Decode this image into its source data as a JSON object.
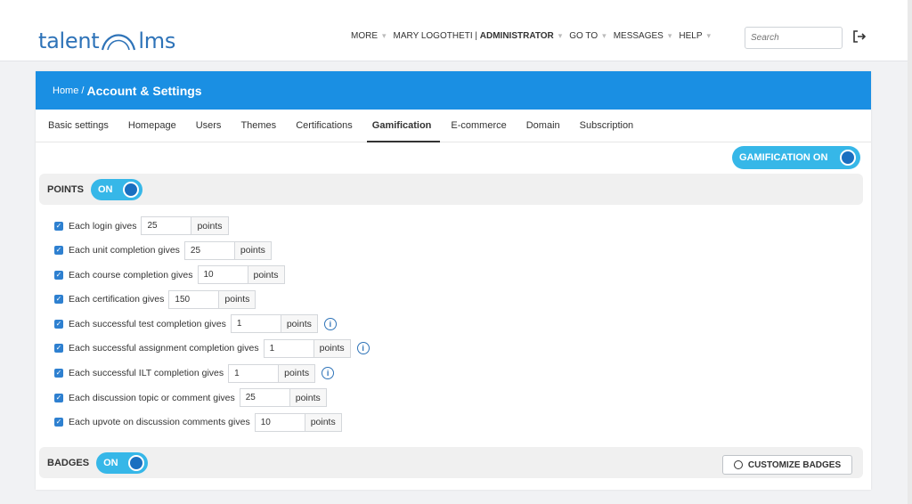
{
  "brand": {
    "logo_left": "talent",
    "logo_right": "lms"
  },
  "topnav": {
    "more": "MORE",
    "user_name": "MARY LOGOTHETI",
    "separator": " | ",
    "user_role": "ADMINISTRATOR",
    "goto": "GO TO",
    "messages": "MESSAGES",
    "help": "HELP",
    "search_placeholder": "Search"
  },
  "header": {
    "home": "Home /",
    "title": "Account & Settings"
  },
  "tabs": [
    {
      "label": "Basic settings"
    },
    {
      "label": "Homepage"
    },
    {
      "label": "Users"
    },
    {
      "label": "Themes"
    },
    {
      "label": "Certifications"
    },
    {
      "label": "Gamification",
      "active": true
    },
    {
      "label": "E-commerce"
    },
    {
      "label": "Domain"
    },
    {
      "label": "Subscription"
    }
  ],
  "gamification_toggle": {
    "label": "GAMIFICATION ON",
    "on": true
  },
  "points_section": {
    "label": "POINTS",
    "toggle": "ON",
    "rows": [
      {
        "label": "Each login gives",
        "value": "25",
        "unit": "points",
        "checked": true,
        "info": false
      },
      {
        "label": "Each unit completion gives",
        "value": "25",
        "unit": "points",
        "checked": true,
        "info": false
      },
      {
        "label": "Each course completion gives",
        "value": "10",
        "unit": "points",
        "checked": true,
        "info": false
      },
      {
        "label": "Each certification gives",
        "value": "150",
        "unit": "points",
        "checked": true,
        "info": false
      },
      {
        "label": "Each successful test completion gives",
        "value": "1",
        "unit": "points",
        "checked": true,
        "info": true
      },
      {
        "label": "Each successful assignment completion gives",
        "value": "1",
        "unit": "points",
        "checked": true,
        "info": true
      },
      {
        "label": "Each successful ILT completion gives",
        "value": "1",
        "unit": "points",
        "checked": true,
        "info": true
      },
      {
        "label": "Each discussion topic or comment gives",
        "value": "25",
        "unit": "points",
        "checked": true,
        "info": false
      },
      {
        "label": "Each upvote on discussion comments gives",
        "value": "10",
        "unit": "points",
        "checked": true,
        "info": false
      }
    ]
  },
  "badges_section": {
    "label": "BADGES",
    "toggle": "ON",
    "customize_label": "CUSTOMIZE BADGES"
  },
  "colors": {
    "primary": "#1a8fe3",
    "toggle": "#36b7e8",
    "link": "#2e73b8"
  },
  "icons": {
    "logo_arc": "arc-icon",
    "logout": "logout-icon",
    "info": "info-icon",
    "check": "checkbox-icon"
  }
}
